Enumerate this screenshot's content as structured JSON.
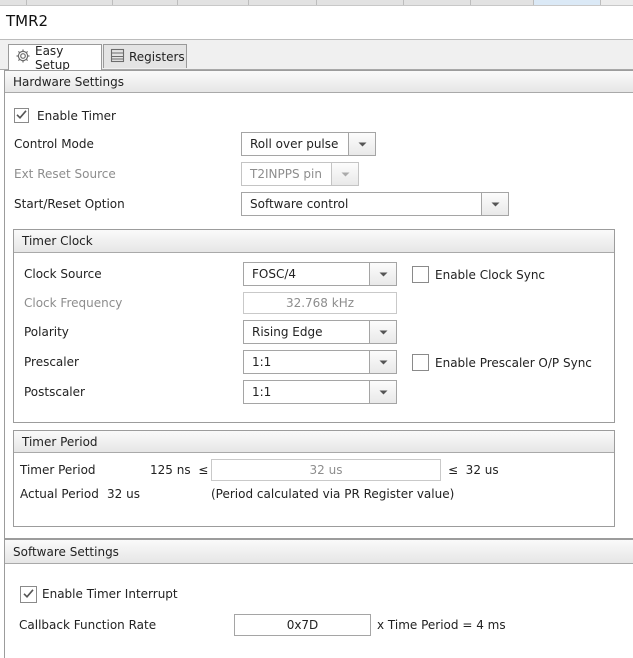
{
  "window": {
    "title": "TMR2"
  },
  "tabs": [
    {
      "label": "Easy Setup",
      "icon": "gear-icon"
    },
    {
      "label": "Registers",
      "icon": "registers-icon"
    }
  ],
  "hardware": {
    "header": "Hardware Settings",
    "enable_timer": {
      "label": "Enable Timer",
      "checked": true
    },
    "control_mode": {
      "label": "Control Mode",
      "value": "Roll over pulse"
    },
    "ext_reset_source": {
      "label": "Ext Reset Source",
      "value": "T2INPPS pin"
    },
    "start_reset_option": {
      "label": "Start/Reset Option",
      "value": "Software control"
    }
  },
  "timer_clock": {
    "header": "Timer Clock",
    "clock_source": {
      "label": "Clock Source",
      "value": "FOSC/4"
    },
    "enable_clock_sync": {
      "label": "Enable Clock Sync",
      "checked": false
    },
    "clock_frequency": {
      "label": "Clock Frequency",
      "value": "32.768 kHz"
    },
    "polarity": {
      "label": "Polarity",
      "value": "Rising Edge"
    },
    "prescaler": {
      "label": "Prescaler",
      "value": "1:1"
    },
    "enable_prescaler_sync": {
      "label": "Enable Prescaler O/P Sync",
      "checked": false
    },
    "postscaler": {
      "label": "Postscaler",
      "value": "1:1"
    }
  },
  "timer_period": {
    "header": "Timer Period",
    "label": "Timer Period",
    "min": "125 ns  ≤",
    "value": "32 us",
    "max": "≤  32 us",
    "actual_label": "Actual Period",
    "actual_value": "32 us",
    "note": "(Period calculated via PR Register value)"
  },
  "software": {
    "header": "Software Settings",
    "enable_interrupt": {
      "label": "Enable Timer Interrupt",
      "checked": true
    },
    "callback_label": "Callback Function Rate",
    "callback_value": "0x7D",
    "callback_suffix": "x Time Period = 4 ms"
  },
  "colors": {
    "accent_tab": "#dbe9f6",
    "section_header": "#e6e6e6",
    "border": "#9c9c9c",
    "disabled_text": "#8d8d8d"
  }
}
